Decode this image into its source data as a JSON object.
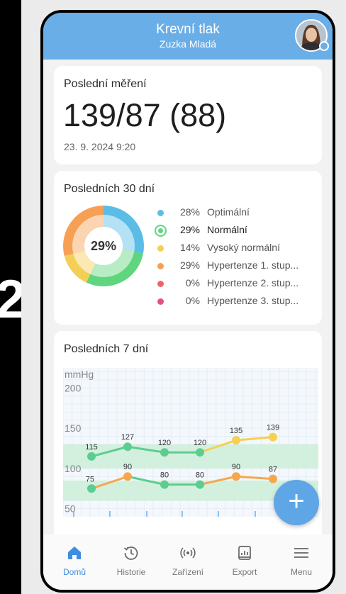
{
  "header": {
    "title": "Krevní tlak",
    "subtitle": "Zuzka Mladá"
  },
  "last_measurement": {
    "title": "Poslední měření",
    "value": "139/87 (88)",
    "timestamp": "23. 9. 2024 9:20"
  },
  "last_30_days": {
    "title": "Posledních 30 dní",
    "center_label": "29%",
    "items": [
      {
        "pct": "28%",
        "label": "Optimální",
        "color": "#5bbde6"
      },
      {
        "pct": "29%",
        "label": "Normální",
        "color": "#5fd67e",
        "selected": true
      },
      {
        "pct": "14%",
        "label": "Vysoký normální",
        "color": "#f4cf55"
      },
      {
        "pct": "29%",
        "label": "Hypertenze 1. stup...",
        "color": "#f6a055"
      },
      {
        "pct": "0%",
        "label": "Hypertenze 2. stup...",
        "color": "#ef6565"
      },
      {
        "pct": "0%",
        "label": "Hypertenze 3. stup...",
        "color": "#e94f7d"
      }
    ]
  },
  "last_7_days": {
    "title": "Posledních 7 dní"
  },
  "chart_data": {
    "type": "line",
    "ylabel": "mmHg",
    "yticks": [
      200,
      150,
      100,
      50
    ],
    "ylim": [
      40,
      225
    ],
    "x": [
      1,
      2,
      3,
      4,
      5,
      6
    ],
    "series": [
      {
        "values": [
          115,
          127,
          120,
          120,
          135,
          139
        ],
        "labels": [
          "115",
          "127",
          "120",
          "120",
          "135",
          "139"
        ]
      },
      {
        "values": [
          75,
          90,
          80,
          80,
          90,
          87
        ],
        "labels": [
          "75",
          "90",
          "80",
          "80",
          "90",
          "87"
        ]
      }
    ]
  },
  "fab": {
    "symbol": "+",
    "icon": "plus-icon"
  },
  "nav": [
    {
      "label": "Domů",
      "icon": "home-icon",
      "active": true
    },
    {
      "label": "Historie",
      "icon": "history-icon"
    },
    {
      "label": "Zařízení",
      "icon": "wireless-device-icon"
    },
    {
      "label": "Export",
      "icon": "export-icon"
    },
    {
      "label": "Menu",
      "icon": "menu-icon"
    }
  ],
  "side_glyph": "2"
}
